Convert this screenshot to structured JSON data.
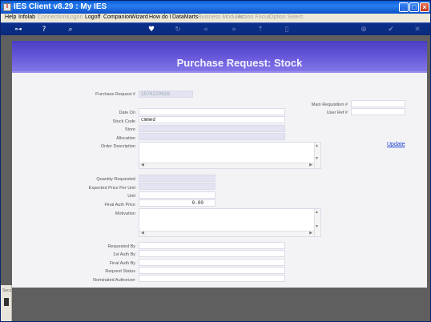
{
  "window": {
    "title": "IES Client v8.29 : My IES",
    "minimize": "_",
    "maximize": "□",
    "close": "×"
  },
  "menu": {
    "help": "Help",
    "infolab": "Infolab",
    "connections": "Connections",
    "logon": "Logon",
    "logoff": "Logoff",
    "companion": "Companion",
    "wizard": "Wizard",
    "howdoi": "How do I",
    "datamarts": "DataMarts",
    "business_modules": "Business Modules",
    "action_focus": "Action Focus",
    "option_select": "Option Select"
  },
  "toolbar": {
    "key": "⊶",
    "help": "?",
    "search": "⌕",
    "heart": "♥",
    "refresh": "↻",
    "back": "«",
    "forward": "»",
    "upload": "⇡",
    "doc": "▯",
    "plus": "⊕",
    "check": "✔",
    "close": "✕"
  },
  "page": {
    "title": "Purchase Request: Stock",
    "update_link": "Update"
  },
  "form": {
    "purchase_request_label": "Purchase Request #",
    "purchase_request_value": "1570229926",
    "main_requisition_label": "Main Requisition #",
    "main_requisition_value": "",
    "user_ref_label": "User Ref #",
    "user_ref_value": "",
    "date_on_label": "Date On",
    "date_on_value": "",
    "stock_code_label": "Stock Code",
    "stock_code_value": "cmmed",
    "store_label": "Store",
    "store_value": "",
    "allocation_label": "Allocation",
    "allocation_value": "",
    "order_description_label": "Order Description",
    "quantity_requested_label": "Quantity Requested",
    "expected_price_label": "Expected Price Per Unit",
    "unit_label": "Unit",
    "final_auth_price_label": "Final Auth Price",
    "final_auth_price_value": "0.00",
    "motivation_label": "Motivation",
    "requested_by_label": "Requested By",
    "first_auth_label": "1st Auth By",
    "final_auth_label": "Final Auth By",
    "request_status_label": "Request Status",
    "nominated_authorizer_label": "Nominated Authorizer"
  },
  "sidebar": {
    "tag": "Secu"
  },
  "colors": {
    "banner": "#5a4cd0",
    "toolbar": "#0b2f8c",
    "link": "#1a3fd0"
  }
}
